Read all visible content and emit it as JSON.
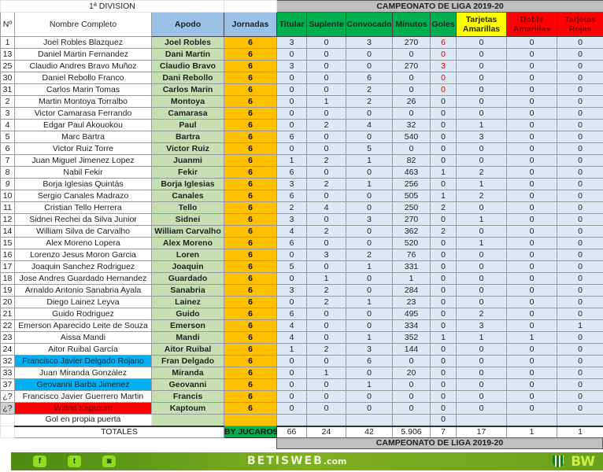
{
  "title": "1ª DIVISION",
  "campeonato": "CAMPEONATO  DE LIGA 2019-20",
  "headers": [
    "Nº",
    "Nombre Completo",
    "Apodo",
    "Jornadas",
    "Titular",
    "Suplente",
    "Convocado",
    "Minutos",
    "Goles",
    "Tarjetas Amarillas",
    "Doble Amarillas",
    "Tarjetas Rojas"
  ],
  "colors": {
    "apodo_header": "#9bc2e6",
    "stats_header": "#00b050",
    "yellow_header": "#ffff00",
    "red_header": "#ff0000",
    "highlight_blue": "#00b0f0",
    "highlight_red": "#ff0000"
  },
  "players": [
    [
      "1",
      "Joel Robles Blazquez",
      "Joel Robles",
      "6",
      "3",
      "0",
      "3",
      "270",
      "6",
      "0",
      "0",
      "0"
    ],
    [
      "13",
      "Daniel Martin Fernandez",
      "Dani Martin",
      "6",
      "0",
      "0",
      "0",
      "0",
      "0",
      "0",
      "0",
      "0"
    ],
    [
      "25",
      "Claudio Andres Bravo Muñoz",
      "Claudio Bravo",
      "6",
      "3",
      "0",
      "0",
      "270",
      "3",
      "0",
      "0",
      "0"
    ],
    [
      "30",
      "Daniel Rebollo Franco",
      "Dani  Rebollo",
      "6",
      "0",
      "0",
      "6",
      "0",
      "0",
      "0",
      "0",
      "0"
    ],
    [
      "31",
      "Carlos Marin Tomas",
      "Carlos Marin",
      "6",
      "0",
      "0",
      "2",
      "0",
      "0",
      "0",
      "0",
      "0"
    ],
    [
      "2",
      "Martin Montoya Torralbo",
      "Montoya",
      "6",
      "0",
      "1",
      "2",
      "26",
      "0",
      "0",
      "0",
      "0"
    ],
    [
      "3",
      "Victor Camarasa Ferrando",
      "Camarasa",
      "6",
      "0",
      "0",
      "0",
      "0",
      "0",
      "0",
      "0",
      "0"
    ],
    [
      "4",
      "Edgar Paul Akouokou",
      "Paul",
      "6",
      "0",
      "2",
      "4",
      "32",
      "0",
      "1",
      "0",
      "0"
    ],
    [
      "5",
      "Marc Bartra",
      "Bartra",
      "6",
      "6",
      "0",
      "0",
      "540",
      "0",
      "3",
      "0",
      "0"
    ],
    [
      "6",
      "Victor Ruiz Torre",
      "Victor Ruiz",
      "6",
      "0",
      "0",
      "5",
      "0",
      "0",
      "0",
      "0",
      "0"
    ],
    [
      "7",
      "Juan Miguel Jimenez Lopez",
      "Juanmi",
      "6",
      "1",
      "2",
      "1",
      "82",
      "0",
      "0",
      "0",
      "0"
    ],
    [
      "8",
      "Nabil Fekir",
      "Fekir",
      "6",
      "6",
      "0",
      "0",
      "463",
      "1",
      "2",
      "0",
      "0"
    ],
    [
      "9",
      "Borja Iglesias Quintás",
      "Borja Iglesias",
      "6",
      "3",
      "2",
      "1",
      "256",
      "0",
      "1",
      "0",
      "0"
    ],
    [
      "10",
      "Sergio Canales Madrazo",
      "Canales",
      "6",
      "6",
      "0",
      "0",
      "505",
      "1",
      "2",
      "0",
      "0"
    ],
    [
      "11",
      "Cristian Tello Herrera",
      "Tello",
      "6",
      "2",
      "4",
      "0",
      "250",
      "2",
      "0",
      "0",
      "0"
    ],
    [
      "12",
      "Sidnei Rechei da Silva Junior",
      "Sidnei",
      "6",
      "3",
      "0",
      "3",
      "270",
      "0",
      "1",
      "0",
      "0"
    ],
    [
      "14",
      "William Silva de Carvalho",
      "William Carvalho",
      "6",
      "4",
      "2",
      "0",
      "362",
      "2",
      "0",
      "0",
      "0"
    ],
    [
      "15",
      "Alex Moreno Lopera",
      "Alex Moreno",
      "6",
      "6",
      "0",
      "0",
      "520",
      "0",
      "1",
      "0",
      "0"
    ],
    [
      "16",
      "Lorenzo Jesus Moron Garcia",
      "Loren",
      "6",
      "0",
      "3",
      "2",
      "76",
      "0",
      "0",
      "0",
      "0"
    ],
    [
      "17",
      "Joaquin Sanchez Rodriguez",
      "Joaquin",
      "6",
      "5",
      "0",
      "1",
      "331",
      "0",
      "0",
      "0",
      "0"
    ],
    [
      "18",
      "Jose Andres Guardado Hernandez",
      "Guardado",
      "6",
      "0",
      "1",
      "0",
      "1",
      "0",
      "0",
      "0",
      "0"
    ],
    [
      "19",
      "Arnaldo Antonio Sanabria Ayala",
      "Sanabria",
      "6",
      "3",
      "2",
      "0",
      "284",
      "0",
      "0",
      "0",
      "0"
    ],
    [
      "20",
      "Diego Lainez Leyva",
      "Lainez",
      "6",
      "0",
      "2",
      "1",
      "23",
      "0",
      "0",
      "0",
      "0"
    ],
    [
      "21",
      "Guido Rodriguez",
      "Guido",
      "6",
      "6",
      "0",
      "0",
      "495",
      "0",
      "2",
      "0",
      "0"
    ],
    [
      "22",
      "Emerson Aparecido Leite de Souza",
      "Emerson",
      "6",
      "4",
      "0",
      "0",
      "334",
      "0",
      "3",
      "0",
      "1"
    ],
    [
      "23",
      "Aissa Mandi",
      "Mandi",
      "6",
      "4",
      "0",
      "1",
      "352",
      "1",
      "1",
      "1",
      "0"
    ],
    [
      "24",
      "Aitor Ruibal García",
      "Aitor Ruibal",
      "6",
      "1",
      "2",
      "3",
      "144",
      "0",
      "0",
      "0",
      "0"
    ],
    [
      "32",
      "Francisco Javier Delgado Rojano",
      "Fran Delgado",
      "6",
      "0",
      "0",
      "6",
      "0",
      "0",
      "0",
      "0",
      "0"
    ],
    [
      "33",
      "Juan Miranda González",
      "Miranda",
      "6",
      "0",
      "1",
      "0",
      "20",
      "0",
      "0",
      "0",
      "0"
    ],
    [
      "37",
      "Geovanni Barba Jimenez",
      "Geovanni",
      "6",
      "0",
      "0",
      "1",
      "0",
      "0",
      "0",
      "0",
      "0"
    ],
    [
      "¿?",
      "Francisco Javier Guerrero Martin",
      "Francis",
      "6",
      "0",
      "0",
      "0",
      "0",
      "0",
      "0",
      "0",
      "0"
    ],
    [
      "¿?",
      "Wilfrid Kaptoum",
      "Kaptoum",
      "6",
      "0",
      "0",
      "0",
      "0",
      "0",
      "0",
      "0",
      "0"
    ]
  ],
  "own_goal": {
    "label": "Gol en propia puerta",
    "goles": "0"
  },
  "totals": {
    "label": "TOTALES",
    "by": "BY JUCARO54",
    "values": [
      "66",
      "24",
      "42",
      "5.906",
      "7",
      "17",
      "1",
      "1"
    ]
  },
  "footer": {
    "brand": "BETISWEB",
    "brand_suffix": ".com",
    "logo": "BW",
    "social": [
      "facebook-icon",
      "twitter-icon",
      "instagram-icon"
    ]
  }
}
